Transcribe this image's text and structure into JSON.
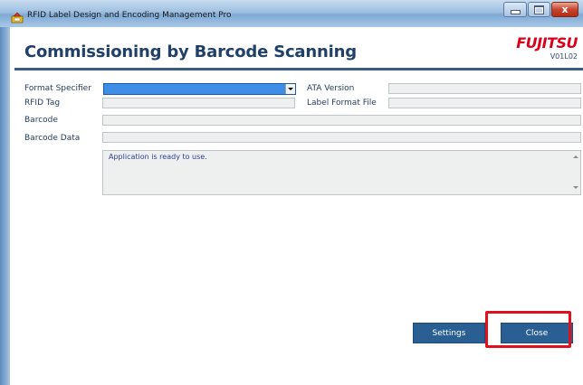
{
  "window": {
    "title": "RFID Label Design and Encoding Management Pro",
    "controls": {
      "minimize": "minimize",
      "maximize": "maximize",
      "close": "x"
    }
  },
  "header": {
    "heading": "Commissioning by Barcode Scanning",
    "logo": "FUJITSU",
    "version": "V01L02"
  },
  "form": {
    "format_specifier_label": "Format Specifier",
    "format_specifier_value": "",
    "rfid_tag_label": "RFID Tag",
    "rfid_tag_value": "",
    "ata_version_label": "ATA Version",
    "ata_version_value": "",
    "label_format_file_label": "Label Format File",
    "label_format_file_value": "",
    "barcode_label": "Barcode",
    "barcode_value": "",
    "barcode_data_label": "Barcode Data",
    "barcode_data_value": ""
  },
  "message": {
    "text": "Application is ready to use."
  },
  "buttons": {
    "settings": "Settings",
    "close": "Close"
  },
  "colors": {
    "heading": "#1f4068",
    "logo": "#d9001b",
    "button": "#2a5f94",
    "highlight": "#e0101d",
    "combo_selected": "#3e8ee8"
  },
  "icons": {
    "app_icon": "rfid-app-icon",
    "combo_arrow": "chevron-down-icon"
  }
}
